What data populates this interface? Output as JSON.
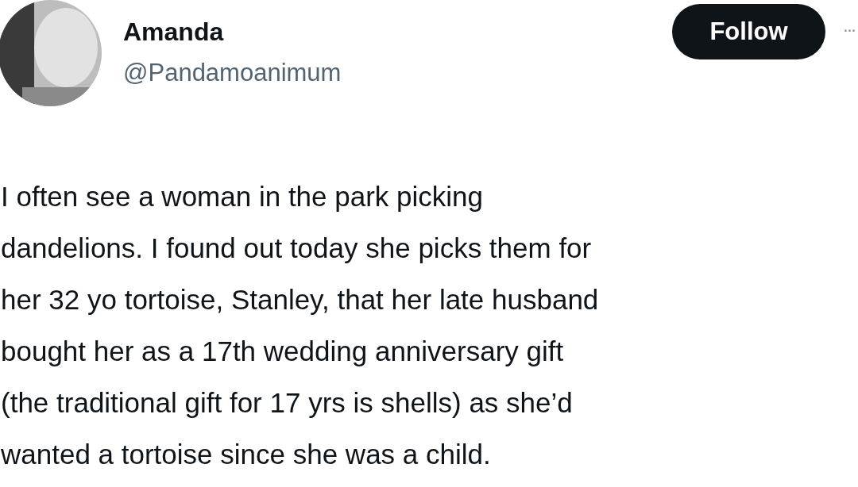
{
  "author": {
    "name": "Amanda",
    "handle": "@Pandamoanimum"
  },
  "follow_button": {
    "label": "Follow"
  },
  "more_button": {
    "label": "···"
  },
  "post": {
    "lines": [
      "I often see a woman in the park picking",
      "dandelions. I found out today she picks them for",
      "her 32 yo tortoise, Stanley, that her late husband",
      "bought her as a 17th wedding anniversary gift",
      "(the traditional gift for 17 yrs is shells) as she’d",
      "wanted a tortoise since she was a child."
    ]
  }
}
